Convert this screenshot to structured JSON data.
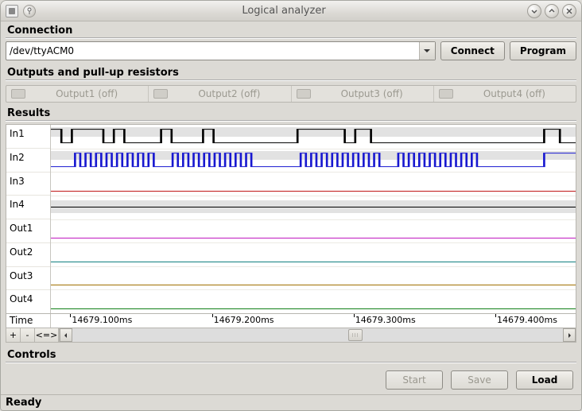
{
  "window": {
    "title": "Logical analyzer"
  },
  "connection": {
    "section_label": "Connection",
    "device": "/dev/ttyACM0",
    "connect_label": "Connect",
    "program_label": "Program"
  },
  "outputs": {
    "section_label": "Outputs and pull-up resistors",
    "items": [
      {
        "label": "Output1 (off)"
      },
      {
        "label": "Output2 (off)"
      },
      {
        "label": "Output3 (off)"
      },
      {
        "label": "Output4 (off)"
      }
    ]
  },
  "results": {
    "section_label": "Results",
    "channels": [
      {
        "name": "In1",
        "color": "#000000"
      },
      {
        "name": "In2",
        "color": "#1818d0"
      },
      {
        "name": "In3",
        "color": "#c01818"
      },
      {
        "name": "In4",
        "color": "#000000"
      },
      {
        "name": "Out1",
        "color": "#c018c0"
      },
      {
        "name": "Out2",
        "color": "#108080"
      },
      {
        "name": "Out3",
        "color": "#a07000"
      },
      {
        "name": "Out4",
        "color": "#108018"
      }
    ],
    "time_label": "Time",
    "time_ticks": [
      {
        "label": "14679.100ms",
        "pos_pct": 4
      },
      {
        "label": "14679.200ms",
        "pos_pct": 31
      },
      {
        "label": "14679.300ms",
        "pos_pct": 58
      },
      {
        "label": "14679.400ms",
        "pos_pct": 85
      }
    ],
    "zoom_buttons": {
      "zoom_in": "+",
      "zoom_out": "-",
      "fit": "<=>"
    }
  },
  "controls": {
    "section_label": "Controls",
    "start_label": "Start",
    "save_label": "Save",
    "load_label": "Load"
  },
  "status": {
    "text": "Ready"
  }
}
